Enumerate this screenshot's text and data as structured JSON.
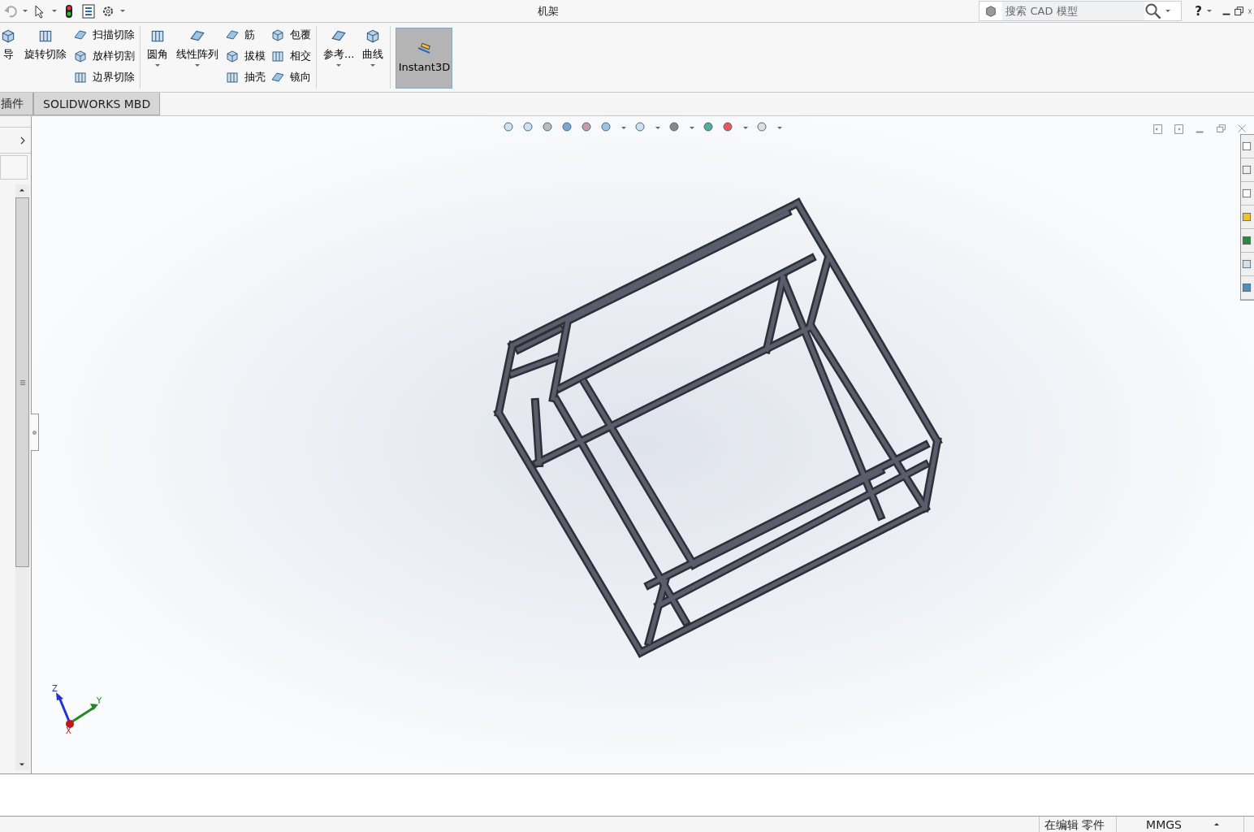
{
  "window": {
    "title": "机架"
  },
  "search": {
    "placeholder": "搜索 CAD 模型"
  },
  "help": {
    "label": "?"
  },
  "ribbon": {
    "groups": [
      {
        "items": [
          {
            "kind": "large",
            "label": "导",
            "dropdown": false
          },
          {
            "kind": "large",
            "label": "旋转切除",
            "dropdown": false
          },
          {
            "kind": "stack",
            "items": [
              {
                "label": "扫描切除"
              },
              {
                "label": "放样切割"
              },
              {
                "label": "边界切除"
              }
            ]
          }
        ]
      },
      {
        "items": [
          {
            "kind": "large",
            "label": "圆角",
            "dropdown": true
          },
          {
            "kind": "large",
            "label": "线性阵列",
            "dropdown": true
          },
          {
            "kind": "stack",
            "items": [
              {
                "label": "筋"
              },
              {
                "label": "拔模"
              },
              {
                "label": "抽壳"
              }
            ]
          },
          {
            "kind": "stack",
            "items": [
              {
                "label": "包覆"
              },
              {
                "label": "相交"
              },
              {
                "label": "镜向"
              }
            ]
          }
        ]
      },
      {
        "items": [
          {
            "kind": "large",
            "label": "参考...",
            "dropdown": true
          },
          {
            "kind": "large",
            "label": "曲线",
            "dropdown": true
          }
        ]
      }
    ],
    "instant3d": {
      "label": "Instant3D",
      "on": true
    }
  },
  "tabs": [
    {
      "label": "插件",
      "selected": false
    },
    {
      "label": "SOLIDWORKS MBD",
      "selected": false
    }
  ],
  "triad": {
    "axes": [
      "Z",
      "Y",
      "X"
    ]
  },
  "status_bar": {
    "mode": "在编辑 零件",
    "units": "MMGS"
  }
}
